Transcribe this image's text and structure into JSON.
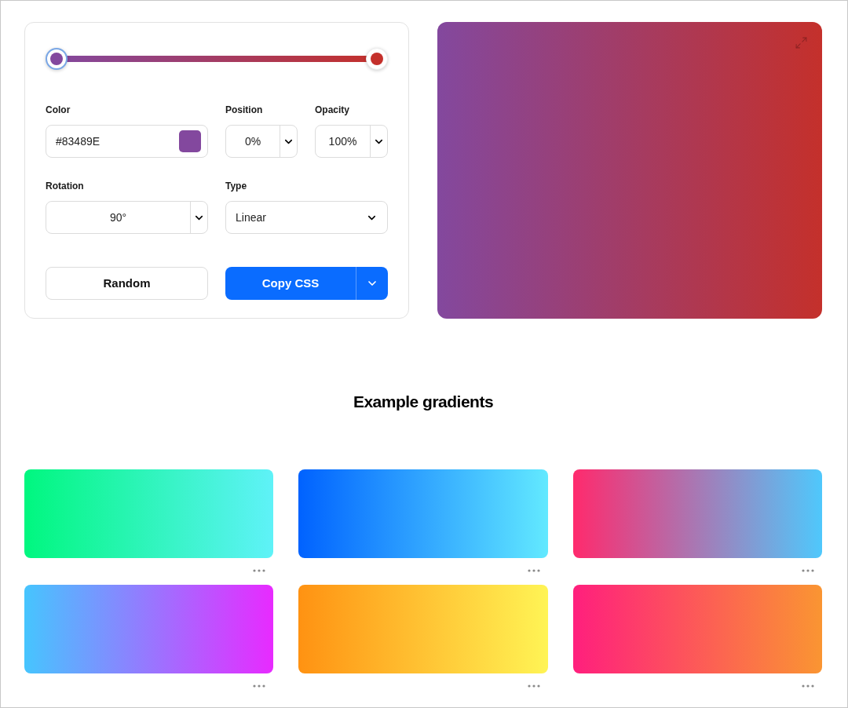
{
  "editor": {
    "stops": [
      {
        "color": "#83489e",
        "selected": true
      },
      {
        "color": "#c4302b",
        "selected": false
      }
    ],
    "color": {
      "label": "Color",
      "value": "#83489E"
    },
    "position": {
      "label": "Position",
      "value": "0%"
    },
    "opacity": {
      "label": "Opacity",
      "value": "100%"
    },
    "rotation": {
      "label": "Rotation",
      "value": "90°"
    },
    "type": {
      "label": "Type",
      "value": "Linear"
    },
    "random_button": "Random",
    "copy_button": "Copy CSS"
  },
  "examples": {
    "title": "Example gradients",
    "swatches": [
      {
        "stops": [
          {
            "color": "#00f77f"
          },
          {
            "color": "#5ff2f8"
          }
        ]
      },
      {
        "stops": [
          {
            "color": "#0062ff"
          },
          {
            "color": "#62e9ff"
          }
        ]
      },
      {
        "stops": [
          {
            "color": "#ff2a6d"
          },
          {
            "color": "#4fc8fc"
          }
        ]
      },
      {
        "stops": [
          {
            "color": "#46c5fe"
          },
          {
            "color": "#e82aff"
          }
        ]
      },
      {
        "stops": [
          {
            "color": "#ff9212"
          },
          {
            "color": "#fff455"
          }
        ]
      },
      {
        "stops": [
          {
            "color": "#ff1f7d"
          },
          {
            "color": "#fa9532"
          }
        ]
      }
    ]
  }
}
